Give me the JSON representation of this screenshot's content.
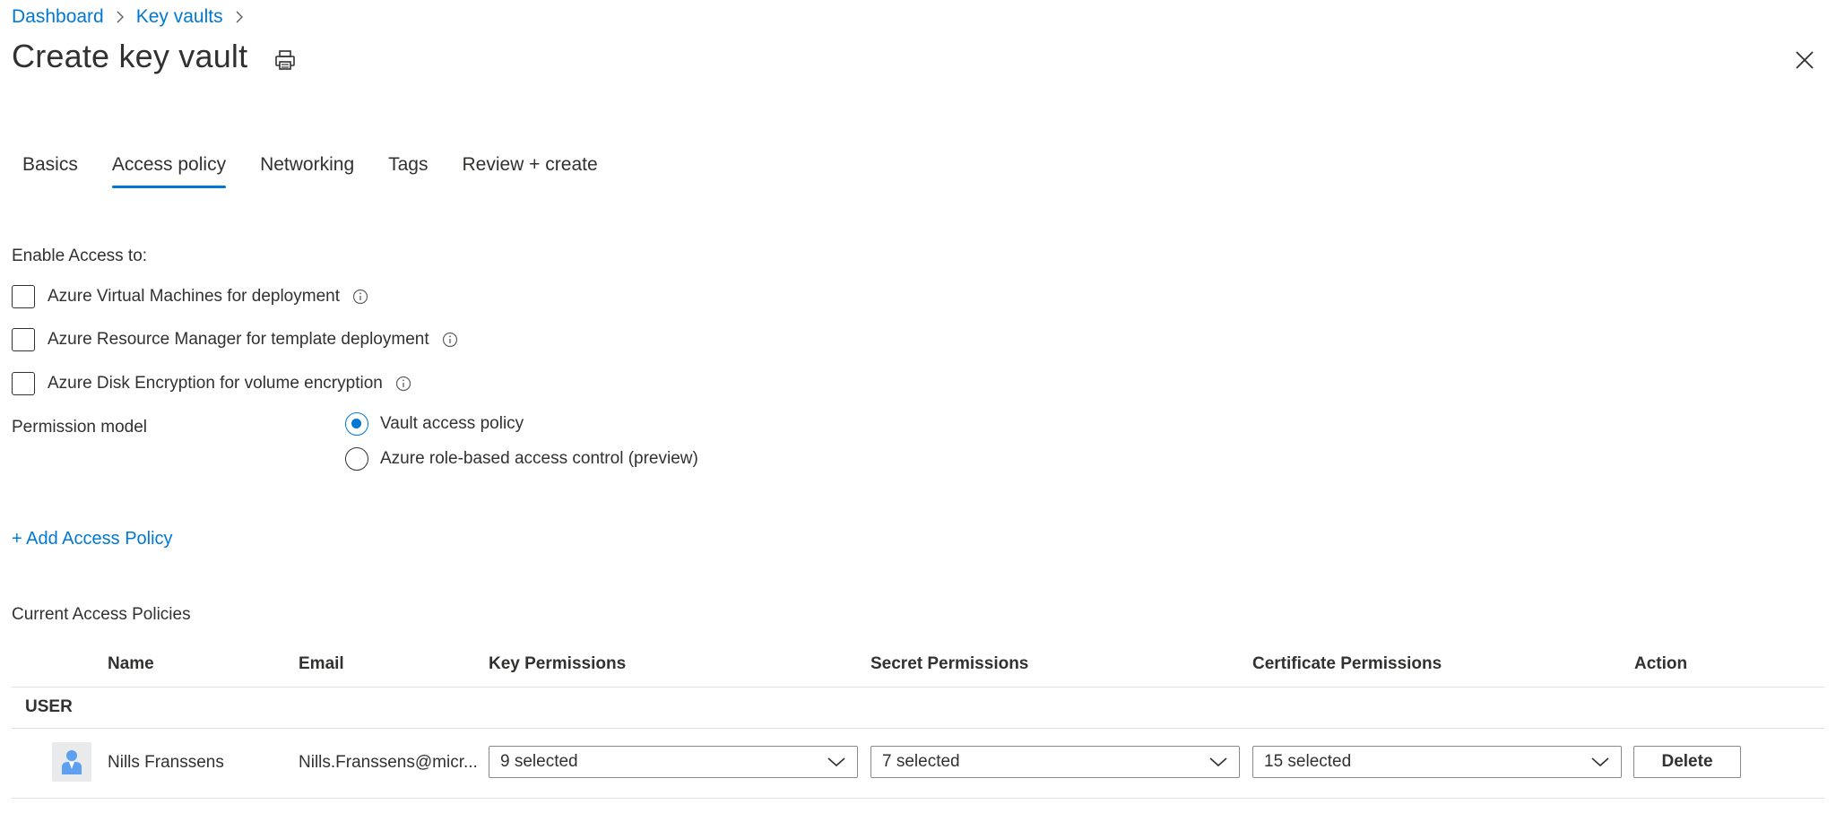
{
  "breadcrumb": [
    {
      "label": "Dashboard"
    },
    {
      "label": "Key vaults"
    }
  ],
  "page": {
    "title": "Create key vault",
    "icons": {
      "print": "print-icon",
      "close": "close-icon"
    }
  },
  "tabs": [
    {
      "label": "Basics",
      "active": false
    },
    {
      "label": "Access policy",
      "active": true
    },
    {
      "label": "Networking",
      "active": false
    },
    {
      "label": "Tags",
      "active": false
    },
    {
      "label": "Review + create",
      "active": false
    }
  ],
  "access": {
    "enable_label": "Enable Access to:",
    "options": [
      {
        "label": "Azure Virtual Machines for deployment",
        "checked": false
      },
      {
        "label": "Azure Resource Manager for template deployment",
        "checked": false
      },
      {
        "label": "Azure Disk Encryption for volume encryption",
        "checked": false
      }
    ]
  },
  "permission_model": {
    "label": "Permission model",
    "options": [
      {
        "label": "Vault access policy",
        "selected": true
      },
      {
        "label": "Azure role-based access control (preview)",
        "selected": false
      }
    ]
  },
  "add_policy_label": "+ Add Access Policy",
  "policies": {
    "section_label": "Current Access Policies",
    "columns": [
      "Name",
      "Email",
      "Key Permissions",
      "Secret Permissions",
      "Certificate Permissions",
      "Action"
    ],
    "group": "USER",
    "rows": [
      {
        "name": "Nills Franssens",
        "email": "Nills.Franssens@micr...",
        "key_permissions": "9 selected",
        "secret_permissions": "7 selected",
        "certificate_permissions": "15 selected",
        "action": "Delete"
      }
    ]
  },
  "colors": {
    "accent": "#0078d4",
    "text": "#323130",
    "border": "#8a8886",
    "divider": "#e1dfdd"
  }
}
